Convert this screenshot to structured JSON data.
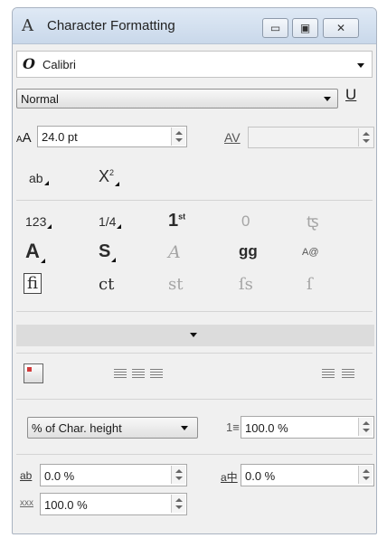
{
  "window": {
    "icon": "A",
    "title": "Character Formatting",
    "minimize_glyph": "▭",
    "maximize_glyph": "▣",
    "close_glyph": "✕"
  },
  "font": {
    "glyph": "O",
    "name": "Calibri"
  },
  "style": {
    "selected": "Normal",
    "underline_label": "U"
  },
  "size": {
    "icon_label": "A",
    "value": "24.0 pt"
  },
  "kerning": {
    "icon_label": "AV",
    "value": ""
  },
  "effects_row1": {
    "underline_glyph": "ab",
    "script_glyph": "X",
    "script_sup": "2"
  },
  "opentype": {
    "row1": [
      "123",
      "1/4",
      "1",
      "0",
      "ꭧ"
    ],
    "row1_sup": "st",
    "row2": [
      "A",
      "S",
      "A",
      "gg",
      "A@"
    ],
    "row3": [
      "fi",
      "ct",
      "st",
      "ſs",
      "ſ"
    ]
  },
  "paragraph": {
    "spacing_unit": "% of Char. height",
    "line_spacing_icon": "1≡",
    "line_spacing_value": "100.0 %"
  },
  "spacing": {
    "char_icon": "ab",
    "char_value": "0.0 %",
    "word_icon": "a中",
    "word_value": "0.0 %",
    "lang_icon": "xxx",
    "lang_value": "100.0 %"
  }
}
